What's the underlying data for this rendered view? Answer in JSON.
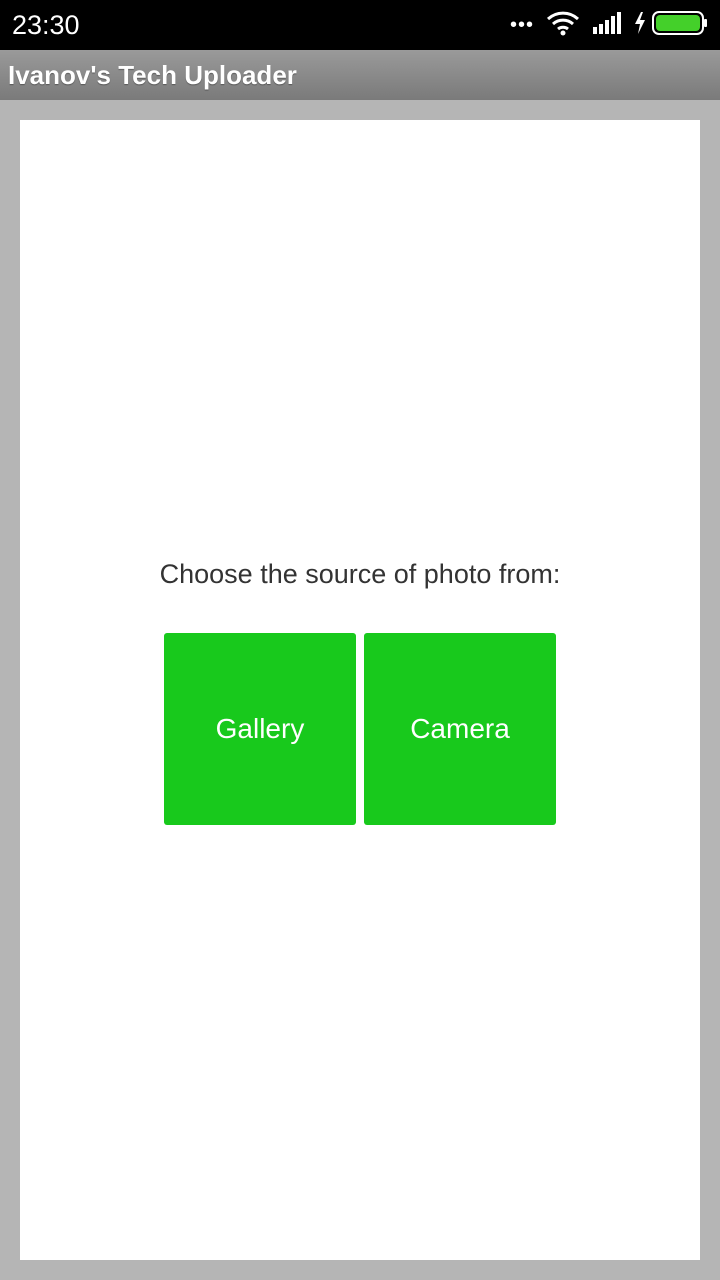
{
  "status_bar": {
    "time": "23:30",
    "icons": [
      "more-dots-icon",
      "wifi-icon",
      "cell-signal-icon",
      "charging-bolt-icon",
      "battery-icon"
    ],
    "battery_color": "#44d02a"
  },
  "app_bar": {
    "title": "Ivanov's Tech Uploader"
  },
  "main": {
    "prompt": "Choose the source of photo from:",
    "buttons": {
      "gallery_label": "Gallery",
      "camera_label": "Camera"
    },
    "accent_color": "#18c91c"
  }
}
